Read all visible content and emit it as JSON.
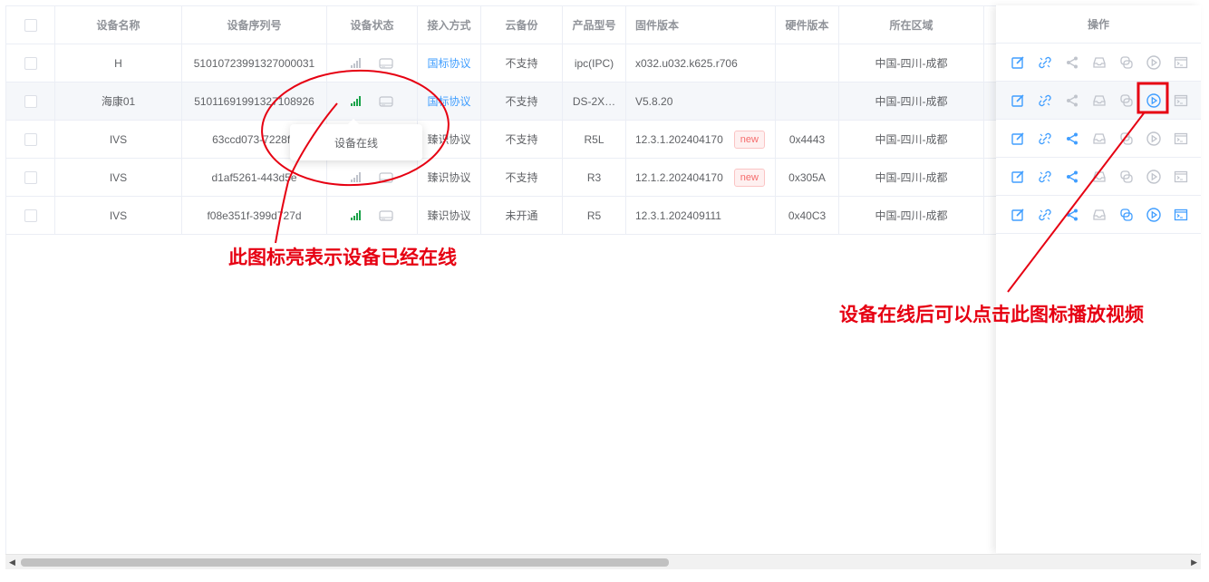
{
  "columns": [
    "",
    "设备名称",
    "设备序列号",
    "设备状态",
    "接入方式",
    "云备份",
    "产品型号",
    "固件版本",
    "硬件版本",
    "所在区域"
  ],
  "operations_header": "操作",
  "rows": [
    {
      "name": "H",
      "serial": "51010723991327000031",
      "online": false,
      "access": "国标协议",
      "access_link": true,
      "cloud": "不支持",
      "model": "ipc(IPC)",
      "firmware": "x032.u032.k625.r706",
      "firmware_new": "",
      "hardware": "",
      "region": "中国-四川-成都"
    },
    {
      "name": "海康01",
      "serial": "51011691991327108926",
      "online": true,
      "access": "国标协议",
      "access_link": true,
      "cloud": "不支持",
      "model": "DS-2X…",
      "firmware": "V5.8.20",
      "firmware_new": "",
      "hardware": "",
      "region": "中国-四川-成都"
    },
    {
      "name": "IVS",
      "serial": "63ccd073-7228f9",
      "online": true,
      "access": "臻识协议",
      "access_link": false,
      "cloud": "不支持",
      "model": "R5L",
      "firmware": "12.3.1.202404170",
      "firmware_new": "new",
      "hardware": "0x4443",
      "region": "中国-四川-成都"
    },
    {
      "name": "IVS",
      "serial": "d1af5261-443d5e",
      "online": false,
      "access": "臻识协议",
      "access_link": false,
      "cloud": "不支持",
      "model": "R3",
      "firmware": "12.1.2.202404170",
      "firmware_new": "new",
      "hardware": "0x305A",
      "region": "中国-四川-成都"
    },
    {
      "name": "IVS",
      "serial": "f08e351f-399d727d",
      "online": true,
      "access": "臻识协议",
      "access_link": false,
      "cloud": "未开通",
      "model": "R5",
      "firmware": "12.3.1.202409111",
      "firmware_new": "",
      "hardware": "0x40C3",
      "region": "中国-四川-成都"
    }
  ],
  "tooltip_text": "设备在线",
  "annotations": {
    "status_note": "此图标亮表示设备已经在线",
    "play_note": "设备在线后可以点击此图标播放视频"
  },
  "colors": {
    "accent": "#409eff",
    "online": "#1aa34a",
    "annotation": "#e60012",
    "new_tag": "#f56c6c"
  },
  "ops_icons": [
    "edit-icon",
    "unlink-icon",
    "share-icon",
    "storage-icon",
    "copy-icon",
    "play-icon",
    "terminal-icon"
  ]
}
